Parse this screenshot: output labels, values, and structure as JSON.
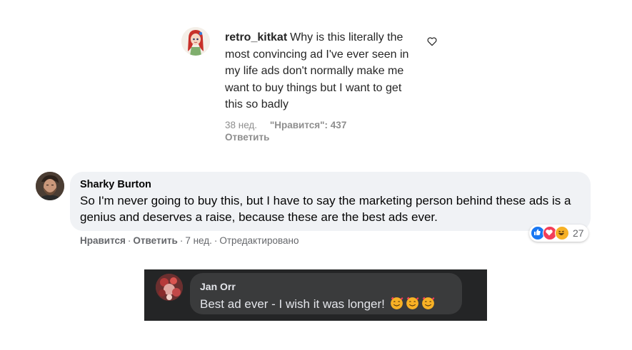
{
  "ig_comment": {
    "username": "retro_kitkat",
    "text": "Why is this literally the most convincing ad I've ever seen in my life ads don't normally make me want to buy things but I want to get this so badly",
    "time": "38 нед.",
    "likes": "\"Нравится\": 437",
    "reply": "Ответить",
    "like_icon": "heart-outline-icon"
  },
  "fb_comment": {
    "author": "Sharky Burton",
    "text": "So I'm never going to buy this, but I have to say the marketing person behind these ads is a genius and deserves a raise, because these are the best ads ever.",
    "like": "Нравится",
    "reply": "Ответить",
    "time": "7 нед.",
    "edited": "Отредактировано",
    "separator": "·",
    "reaction_count": "27",
    "reactions": [
      "like",
      "love",
      "haha"
    ],
    "colors": {
      "like": "#1877f2",
      "love": "#f33e58",
      "haha": "#f7b125"
    }
  },
  "dark_comment": {
    "author": "Jan Orr",
    "text": "Best ad ever - I wish it was longer!",
    "emoji": [
      "smiling-face-with-hearts",
      "smiling-face-with-hearts",
      "smiling-face-with-hearts"
    ],
    "colors": {
      "background": "#242526",
      "bubble": "#3a3b3c",
      "text": "#e4e6eb"
    }
  }
}
